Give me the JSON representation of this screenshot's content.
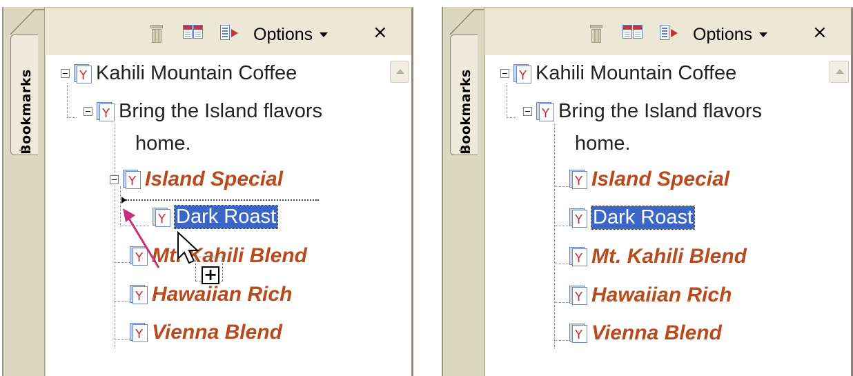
{
  "panels": [
    {
      "tab_label": "Bookmarks",
      "toolbar": {
        "options_label": "Options",
        "close_label": "×"
      },
      "tree": {
        "root": "Kahili Mountain Coffee",
        "child_line1": "Bring the Island flavors",
        "child_line2": "home.",
        "items": [
          "Island Special",
          "Dark Roast",
          "Mt. Kahili Blend",
          "Hawaiian Rich",
          "Vienna Blend"
        ],
        "selected": "Dark Roast",
        "state": "dragging Dark Roast under Island Special"
      }
    },
    {
      "tab_label": "Bookmarks",
      "toolbar": {
        "options_label": "Options",
        "close_label": "×"
      },
      "tree": {
        "root": "Kahili Mountain Coffee",
        "child_line1": "Bring the Island flavors",
        "child_line2": "home.",
        "items": [
          "Island Special",
          "Dark Roast",
          "Mt. Kahili Blend",
          "Hawaiian Rich",
          "Vienna Blend"
        ],
        "selected": "Dark Roast"
      }
    }
  ],
  "colors": {
    "bookmark_emphasis": "#b84a1d",
    "selection": "#3a66c8",
    "drag_arrow": "#c4307a",
    "tab_strip": "#dcd7c1"
  },
  "icons": [
    "trash-icon",
    "new-bookmark-icon",
    "expand-bookmark-icon",
    "pdf-bookmark-icon",
    "close-icon"
  ]
}
